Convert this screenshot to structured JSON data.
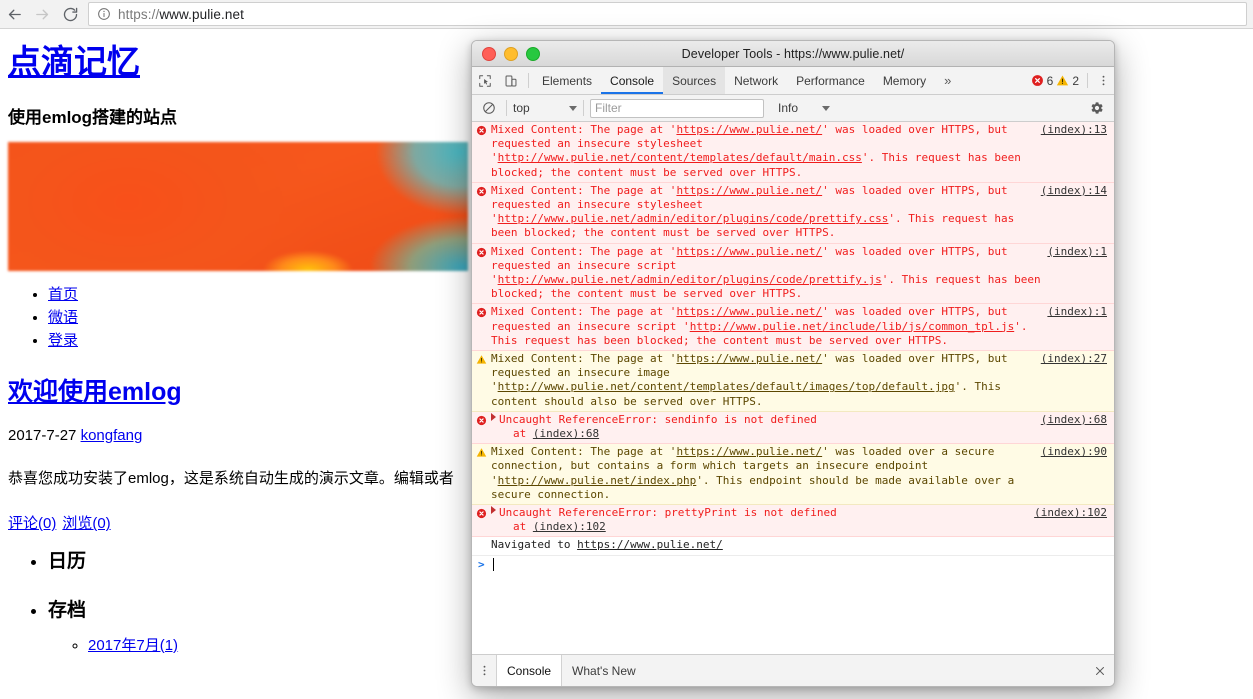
{
  "browser": {
    "back_icon": "back-arrow-icon",
    "forward_icon": "forward-arrow-icon",
    "reload_icon": "reload-icon",
    "site_info_icon": "info-circle-icon",
    "url_scheme": "https://",
    "url_rest": "www.pulie.net",
    "url_full": "https://www.pulie.net"
  },
  "webpage": {
    "site_title": "点滴记忆",
    "site_subtitle": "使用emlog搭建的站点",
    "hero_image": "blurred-orange-banner-image",
    "nav": [
      "首页",
      "微语",
      "登录"
    ],
    "post_title": "欢迎使用emlog",
    "post_date": "2017-7-27",
    "post_author": "kongfang",
    "post_body": "恭喜您成功安装了emlog，这是系统自动生成的演示文章。编辑或者",
    "post_links": [
      "评论(0)",
      "浏览(0)"
    ],
    "widgets": [
      {
        "label": "日历",
        "items": []
      },
      {
        "label": "存档",
        "items": [
          "2017年7月(1)"
        ]
      }
    ],
    "link_color": "#0000ee"
  },
  "devtools": {
    "window_title": "Developer Tools - https://www.pulie.net/",
    "traffic_lights": [
      "close-button",
      "minimize-button",
      "maximize-button"
    ],
    "toolbar_icons": [
      "inspect-element-icon",
      "device-toolbar-icon"
    ],
    "tabs": [
      {
        "label": "Elements",
        "state": "normal"
      },
      {
        "label": "Console",
        "state": "active"
      },
      {
        "label": "Sources",
        "state": "hover"
      },
      {
        "label": "Network",
        "state": "normal"
      },
      {
        "label": "Performance",
        "state": "normal"
      },
      {
        "label": "Memory",
        "state": "normal"
      }
    ],
    "more_tabs": "»",
    "error_count": "6",
    "warning_count": "2",
    "kebab_icon": "more-options-icon",
    "filter_bar": {
      "clear_icon": "clear-console-icon",
      "context": "top",
      "filter_placeholder": "Filter",
      "filter_value": "",
      "level": "Info",
      "settings_icon": "settings-gear-icon"
    },
    "messages": [
      {
        "type": "error",
        "icon": "error-circle-icon",
        "segments": [
          {
            "t": "Mixed Content: The page at '",
            "u": false
          },
          {
            "t": "https://www.pulie.net/",
            "u": true
          },
          {
            "t": "' was loaded over HTTPS, but requested an insecure stylesheet '",
            "u": false
          },
          {
            "t": "http://www.pulie.net/content/templates/default/main.css",
            "u": true
          },
          {
            "t": "'. This request has been blocked; the content must be served over HTTPS.",
            "u": false
          }
        ],
        "source": "(index):13"
      },
      {
        "type": "error",
        "icon": "error-circle-icon",
        "segments": [
          {
            "t": "Mixed Content: The page at '",
            "u": false
          },
          {
            "t": "https://www.pulie.net/",
            "u": true
          },
          {
            "t": "' was loaded over HTTPS, but requested an insecure stylesheet '",
            "u": false
          },
          {
            "t": "http://www.pulie.net/admin/editor/plugins/code/prettify.css",
            "u": true
          },
          {
            "t": "'. This request has been blocked; the content must be served over HTTPS.",
            "u": false
          }
        ],
        "source": "(index):14"
      },
      {
        "type": "error",
        "icon": "error-circle-icon",
        "segments": [
          {
            "t": "Mixed Content: The page at '",
            "u": false
          },
          {
            "t": "https://www.pulie.net/",
            "u": true
          },
          {
            "t": "' was loaded over HTTPS, but requested an insecure script '",
            "u": false
          },
          {
            "t": "http://www.pulie.net/admin/editor/plugins/code/prettify.js",
            "u": true
          },
          {
            "t": "'. This request has been blocked; the content must be served over HTTPS.",
            "u": false
          }
        ],
        "source": "(index):1"
      },
      {
        "type": "error",
        "icon": "error-circle-icon",
        "segments": [
          {
            "t": "Mixed Content: The page at '",
            "u": false
          },
          {
            "t": "https://www.pulie.net/",
            "u": true
          },
          {
            "t": "' was loaded over HTTPS, but requested an insecure script '",
            "u": false
          },
          {
            "t": "http://www.pulie.net/include/lib/js/common_tpl.js",
            "u": true
          },
          {
            "t": "'. This request has been blocked; the content must be served over HTTPS.",
            "u": false
          }
        ],
        "source": "(index):1"
      },
      {
        "type": "warn",
        "icon": "warning-triangle-icon",
        "segments": [
          {
            "t": "Mixed Content: The page at '",
            "u": false
          },
          {
            "t": "https://www.pulie.net/",
            "u": true
          },
          {
            "t": "' was loaded over HTTPS, but requested an insecure image '",
            "u": false
          },
          {
            "t": "http://www.pulie.net/content/templates/default/images/top/default.jpg",
            "u": true
          },
          {
            "t": "'. This content should also be served over HTTPS.",
            "u": false
          }
        ],
        "source": "(index):27"
      },
      {
        "type": "error",
        "icon": "error-circle-icon",
        "expandable": true,
        "headline": "Uncaught ReferenceError: sendinfo is not defined",
        "stack_prefix": "at ",
        "stack_link": "(index):68",
        "source": "(index):68"
      },
      {
        "type": "warn",
        "icon": "warning-triangle-icon",
        "segments": [
          {
            "t": "Mixed Content: The page at '",
            "u": false
          },
          {
            "t": "https://www.pulie.net/",
            "u": true
          },
          {
            "t": "' was loaded over a secure connection, but contains a form which targets an insecure endpoint '",
            "u": false
          },
          {
            "t": "http://www.pulie.net/index.php",
            "u": true
          },
          {
            "t": "'. This endpoint should be made available over a secure connection.",
            "u": false
          }
        ],
        "source": "(index):90"
      },
      {
        "type": "error",
        "icon": "error-circle-icon",
        "expandable": true,
        "headline": "Uncaught ReferenceError: prettyPrint is not defined",
        "stack_prefix": "at ",
        "stack_link": "(index):102",
        "source": "(index):102"
      },
      {
        "type": "info",
        "icon": "none",
        "segments": [
          {
            "t": "Navigated to ",
            "u": false
          },
          {
            "t": "https://www.pulie.net/",
            "u": true
          }
        ],
        "source": ""
      }
    ],
    "prompt": {
      "caret": ">",
      "value": ""
    },
    "drawer": {
      "kebab_icon": "more-tools-icon",
      "tabs": [
        {
          "label": "Console",
          "state": "active"
        },
        {
          "label": "What's New",
          "state": "normal"
        }
      ],
      "close_icon": "close-drawer-icon"
    },
    "colors": {
      "error_text": "#f01d1d",
      "error_bg": "#fff0f0",
      "warn_bg": "#fffbe5",
      "active_tab_underline": "#1a73e8"
    }
  }
}
